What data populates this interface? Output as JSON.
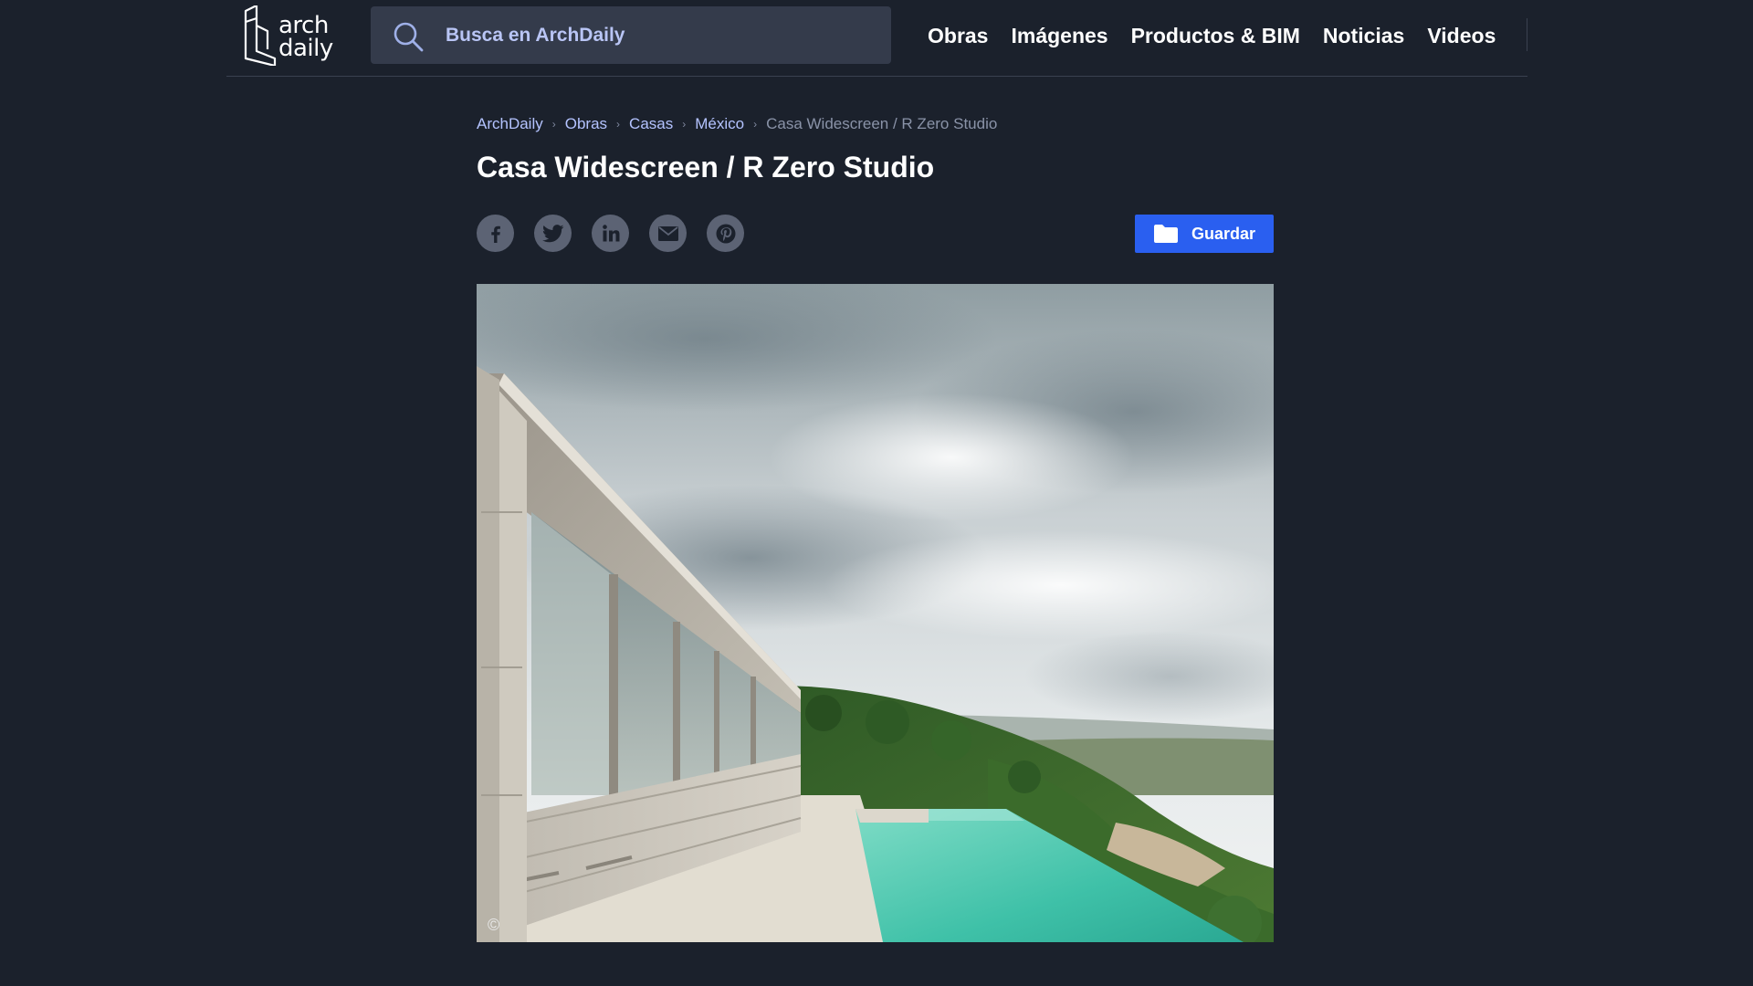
{
  "site": {
    "logo_top": "arch",
    "logo_bottom": "daily"
  },
  "search": {
    "placeholder": "Busca en ArchDaily",
    "icon": "search-icon"
  },
  "nav": {
    "items": [
      "Obras",
      "Imágenes",
      "Productos & BIM",
      "Noticias",
      "Videos"
    ]
  },
  "breadcrumb": {
    "items": [
      "ArchDaily",
      "Obras",
      "Casas",
      "México"
    ],
    "current": "Casa Widescreen / R Zero Studio",
    "separator": "›"
  },
  "article": {
    "title": "Casa Widescreen / R Zero Studio"
  },
  "share": {
    "icons": [
      "facebook-icon",
      "twitter-icon",
      "linkedin-icon",
      "email-icon",
      "pinterest-icon"
    ]
  },
  "save": {
    "label": "Guardar",
    "icon": "folder-icon"
  },
  "hero_image": {
    "copyright_symbol": "©"
  },
  "colors": {
    "background": "#1b212c",
    "search_bg": "#343b4b",
    "link": "#b4c3ff",
    "accent_button": "#2a5ff0",
    "share_icon_bg": "#5c6374"
  }
}
